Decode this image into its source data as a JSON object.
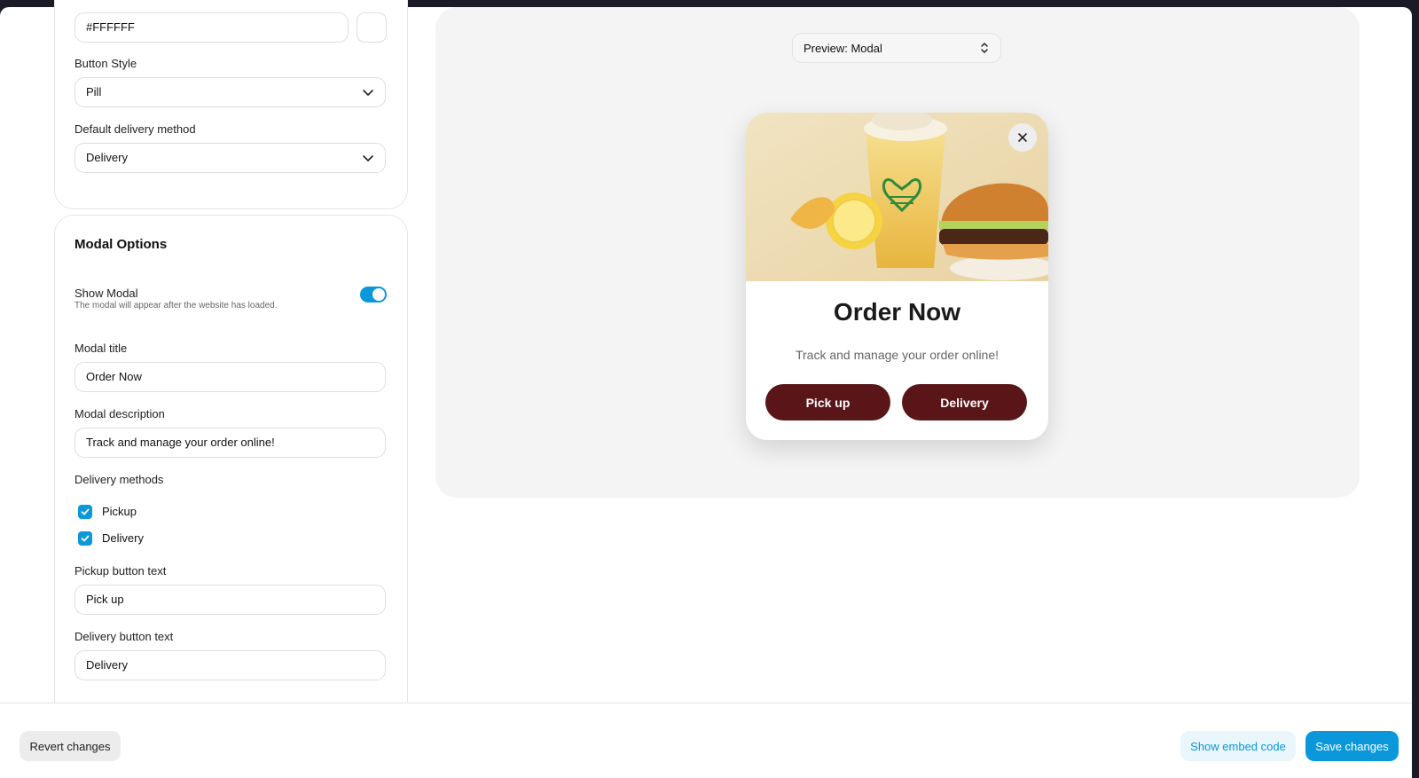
{
  "color_field": {
    "value": "#FFFFFF"
  },
  "button_style": {
    "label": "Button Style",
    "value": "Pill"
  },
  "default_delivery": {
    "label": "Default delivery method",
    "value": "Delivery"
  },
  "modal_options": {
    "title": "Modal Options",
    "show_modal": {
      "label": "Show Modal",
      "hint": "The modal will appear after the website has loaded.",
      "enabled": true
    },
    "modal_title": {
      "label": "Modal title",
      "value": "Order Now"
    },
    "modal_description": {
      "label": "Modal description",
      "value": "Track and manage your order online!"
    },
    "delivery_methods": {
      "label": "Delivery methods",
      "options": [
        {
          "label": "Pickup",
          "checked": true
        },
        {
          "label": "Delivery",
          "checked": true
        }
      ]
    },
    "pickup_button_text": {
      "label": "Pickup button text",
      "value": "Pick up"
    },
    "delivery_button_text": {
      "label": "Delivery button text",
      "value": "Delivery"
    }
  },
  "preview": {
    "select_value": "Preview: Modal",
    "modal": {
      "title": "Order Now",
      "description": "Track and manage your order online!",
      "pickup_button": "Pick up",
      "delivery_button": "Delivery",
      "close_icon": "close-icon"
    }
  },
  "footer": {
    "revert": "Revert changes",
    "embed": "Show embed code",
    "save": "Save changes"
  },
  "colors": {
    "accent": "#0a98db",
    "modal_button": "#5a1518"
  }
}
